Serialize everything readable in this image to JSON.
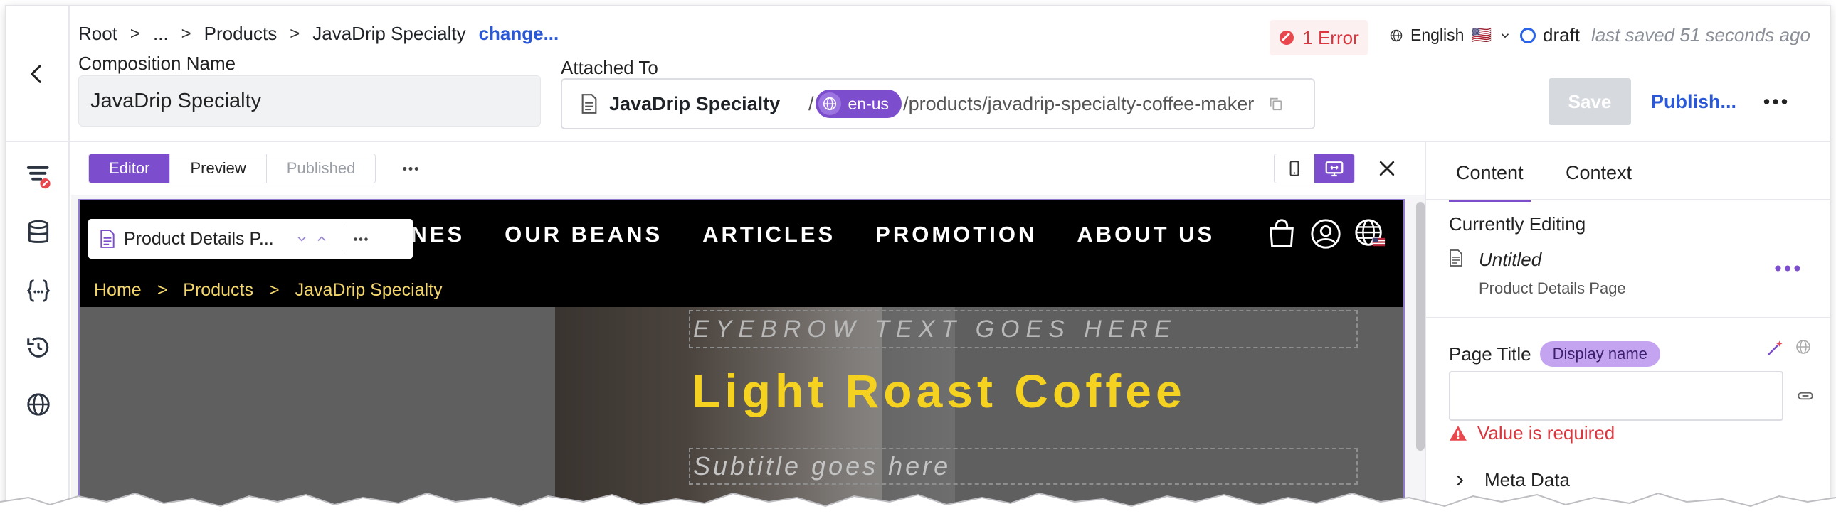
{
  "header": {
    "breadcrumb": [
      "Root",
      "...",
      "Products",
      "JavaDrip Specialty"
    ],
    "breadcrumb_change": "change...",
    "composition_label": "Composition Name",
    "composition_value": "JavaDrip Specialty",
    "attached_label": "Attached To",
    "attached_title": "JavaDrip Specialty",
    "attached_slash": "/",
    "attached_locale": "en-us",
    "attached_path": "/products/javadrip-specialty-coffee-maker",
    "error_text": "1 Error",
    "language": "English",
    "language_flag": "🇺🇸",
    "status": "draft",
    "last_saved": "last saved 51 seconds ago",
    "save_label": "Save",
    "publish_label": "Publish..."
  },
  "toolbar": {
    "modes": [
      "Editor",
      "Preview",
      "Published"
    ],
    "active_mode": "Editor"
  },
  "site": {
    "nav": [
      "CHINES",
      "OUR BEANS",
      "ARTICLES",
      "PROMOTION",
      "ABOUT US"
    ],
    "crumbs": [
      "Home",
      "Products",
      "JavaDrip Specialty"
    ],
    "eyebrow": "EYEBROW TEXT GOES HERE",
    "title": "Light Roast Coffee",
    "subtitle": "Subtitle goes here",
    "component_picker": "Product Details P..."
  },
  "panel": {
    "tabs": [
      "Content",
      "Context"
    ],
    "active_tab": "Content",
    "currently_editing": "Currently Editing",
    "item_name": "Untitled",
    "item_type": "Product Details Page",
    "page_title_label": "Page Title",
    "page_title_pill": "Display name",
    "page_title_value": "",
    "error": "Value is required",
    "meta": "Meta Data"
  },
  "colors": {
    "accent": "#7c4dcc",
    "link": "#2a58d6",
    "error": "#d9363e",
    "hero_title": "#f5d21f",
    "crumb": "#f3d66b"
  }
}
